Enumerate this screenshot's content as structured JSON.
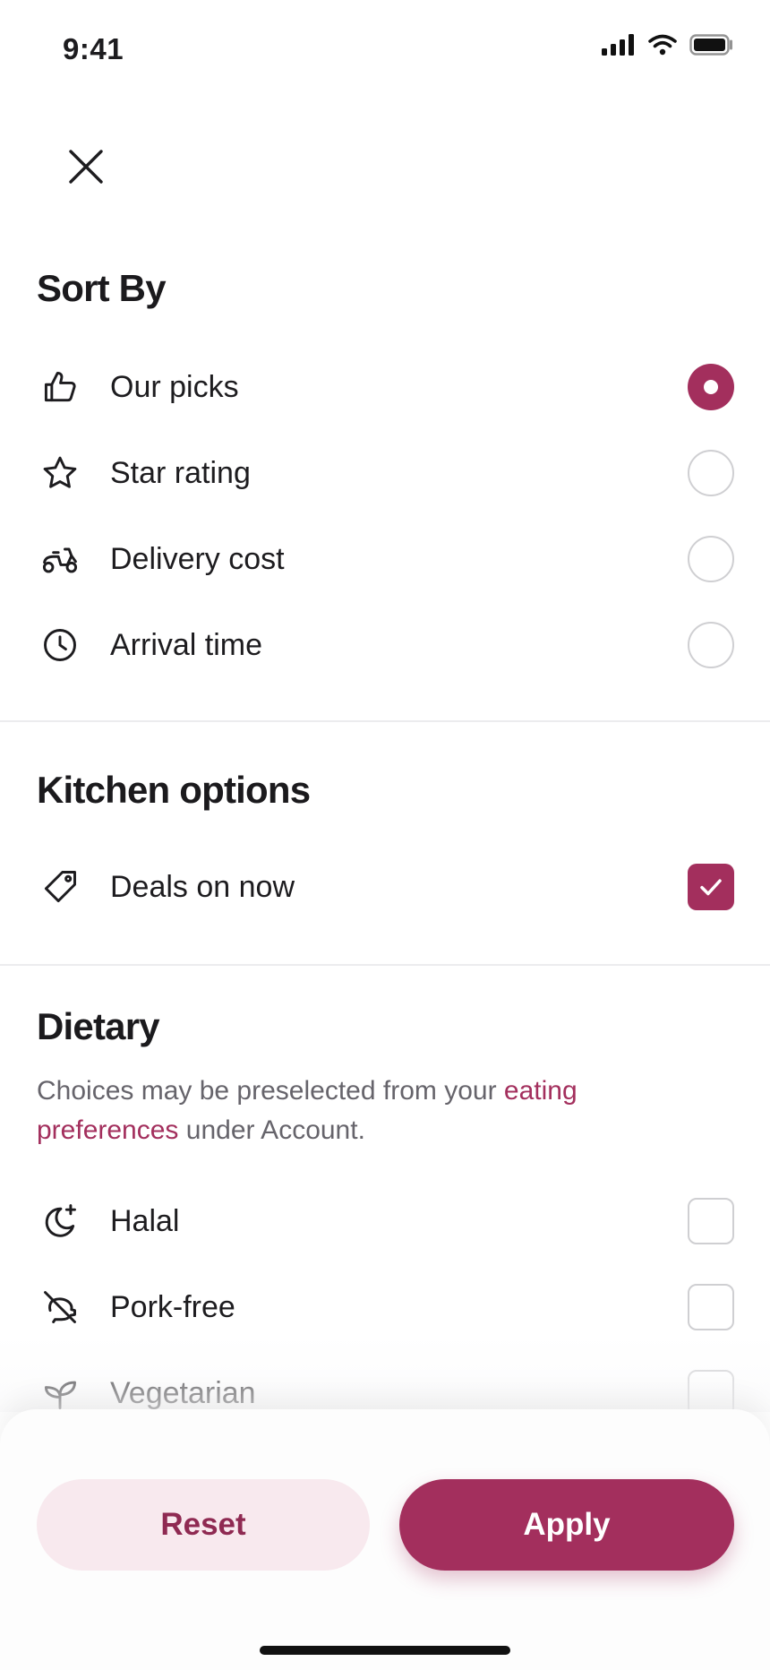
{
  "status_bar": {
    "time": "9:41"
  },
  "sort_by": {
    "title": "Sort By",
    "options": [
      {
        "label": "Our picks",
        "icon": "thumbs-up-icon",
        "selected": true
      },
      {
        "label": "Star rating",
        "icon": "star-icon",
        "selected": false
      },
      {
        "label": "Delivery cost",
        "icon": "scooter-icon",
        "selected": false
      },
      {
        "label": "Arrival time",
        "icon": "clock-icon",
        "selected": false
      }
    ]
  },
  "kitchen_options": {
    "title": "Kitchen options",
    "options": [
      {
        "label": "Deals on now",
        "icon": "tag-icon",
        "checked": true
      }
    ]
  },
  "dietary": {
    "title": "Dietary",
    "description_prefix": "Choices may be preselected from your ",
    "description_link": "eating preferences",
    "description_suffix": " under Account.",
    "options": [
      {
        "label": "Halal",
        "icon": "crescent-star-icon",
        "checked": false
      },
      {
        "label": "Pork-free",
        "icon": "no-pork-icon",
        "checked": false
      },
      {
        "label": "Vegetarian",
        "icon": "leaf-icon",
        "checked": false
      }
    ]
  },
  "footer": {
    "reset_label": "Reset",
    "apply_label": "Apply"
  },
  "colors": {
    "accent": "#a32f5d",
    "accent_light": "#f8e9ee",
    "text": "#1d1c1f",
    "muted": "#66646b"
  }
}
